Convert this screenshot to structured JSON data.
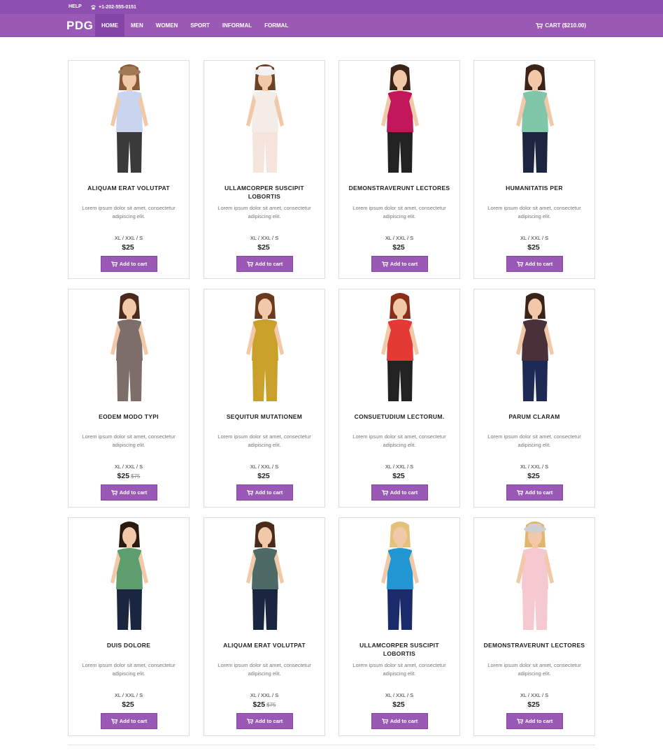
{
  "topbar": {
    "help": "HELP",
    "phone": "+1-202-555-0151"
  },
  "nav": {
    "brand": "PDG",
    "items": [
      "HOME",
      "MEN",
      "WOMEN",
      "SPORT",
      "INFORMAL",
      "FORMAL"
    ],
    "cart": "CART ($210.00)"
  },
  "products": [
    {
      "title": "ALIQUAM ERAT VOLUTPAT",
      "desc": "Lorem ipsum dolor sit amet, consectetur adipiscing elit.",
      "sizes": "XL / XXL / S",
      "price": "$25",
      "old_price": "",
      "button": "Add to cart",
      "colors": {
        "top": "#c9d4ee",
        "bottom": "#3a3a3a",
        "hair": "#8a5a3a",
        "hat": "#a07a55"
      }
    },
    {
      "title": "ULLAMCORPER SUSCIPIT LOBORTIS",
      "desc": "Lorem ipsum dolor sit amet, consectetur adipiscing elit.",
      "sizes": "XL / XXL / S",
      "price": "$25",
      "old_price": "",
      "button": "Add to cart",
      "colors": {
        "top": "#f4ece6",
        "bottom": "#f4e4dc",
        "hair": "#6b4226",
        "hat": "#f2f2f2"
      }
    },
    {
      "title": "DEMONSTRAVERUNT LECTORES",
      "desc": "Lorem ipsum dolor sit amet, consectetur adipiscing elit.",
      "sizes": "XL / XXL / S",
      "price": "$25",
      "old_price": "",
      "button": "Add to cart",
      "colors": {
        "top": "#c2185b",
        "bottom": "#222222",
        "hair": "#3a2418",
        "hat": ""
      }
    },
    {
      "title": "HUMANITATIS PER",
      "desc": "Lorem ipsum dolor sit amet, consectetur adipiscing elit.",
      "sizes": "XL / XXL / S",
      "price": "$25",
      "old_price": "",
      "button": "Add to cart",
      "colors": {
        "top": "#7fc7a8",
        "bottom": "#1d2540",
        "hair": "#3a2418",
        "hat": ""
      }
    },
    {
      "title": "EODEM MODO TYPI",
      "desc": "Lorem ipsum dolor sit amet, consectetur adipiscing elit.",
      "sizes": "XL / XXL / S",
      "price": "$25",
      "old_price": "$75",
      "button": "Add to cart",
      "colors": {
        "top": "#7d6e6a",
        "bottom": "#7d6e6a",
        "hair": "#4a2a1a",
        "hat": ""
      }
    },
    {
      "title": "SEQUITUR MUTATIONEM",
      "desc": "Lorem ipsum dolor sit amet, consectetur adipiscing elit.",
      "sizes": "XL / XXL / S",
      "price": "$25",
      "old_price": "",
      "button": "Add to cart",
      "colors": {
        "top": "#c9a02a",
        "bottom": "#c9a02a",
        "hair": "#6b3a1e",
        "hat": ""
      }
    },
    {
      "title": "CONSUETUDIUM LECTORUM.",
      "desc": "Lorem ipsum dolor sit amet, consectetur adipiscing elit.",
      "sizes": "XL / XXL / S",
      "price": "$25",
      "old_price": "",
      "button": "Add to cart",
      "colors": {
        "top": "#e53935",
        "bottom": "#222222",
        "hair": "#8a2e1a",
        "hat": ""
      }
    },
    {
      "title": "PARUM CLARAM",
      "desc": "Lorem ipsum dolor sit amet, consectetur adipiscing elit.",
      "sizes": "XL / XXL / S",
      "price": "$25",
      "old_price": "",
      "button": "Add to cart",
      "colors": {
        "top": "#4a3038",
        "bottom": "#1d2a55",
        "hair": "#3a2418",
        "hat": ""
      }
    },
    {
      "title": "DUIS DOLORE",
      "desc": "Lorem ipsum dolor sit amet, consectetur adipiscing elit.",
      "sizes": "XL / XXL / S",
      "price": "$25",
      "old_price": "",
      "button": "Add to cart",
      "colors": {
        "top": "#5e9e6e",
        "bottom": "#1a2540",
        "hair": "#2a1a10",
        "hat": ""
      }
    },
    {
      "title": "ALIQUAM ERAT VOLUTPAT",
      "desc": "Lorem ipsum dolor sit amet, consectetur adipiscing elit.",
      "sizes": "XL / XXL / S",
      "price": "$25",
      "old_price": "$75",
      "button": "Add to cart",
      "colors": {
        "top": "#4e6a66",
        "bottom": "#1a2540",
        "hair": "#4a2a1a",
        "hat": ""
      }
    },
    {
      "title": "ULLAMCORPER SUSCIPIT LOBORTIS",
      "desc": "Lorem ipsum dolor sit amet, consectetur adipiscing elit.",
      "sizes": "XL / XXL / S",
      "price": "$25",
      "old_price": "",
      "button": "Add to cart",
      "colors": {
        "top": "#2196d3",
        "bottom": "#1a2a6a",
        "hair": "#e5c27a",
        "hat": ""
      }
    },
    {
      "title": "DEMONSTRAVERUNT LECTORES",
      "desc": "Lorem ipsum dolor sit amet, consectetur adipiscing elit.",
      "sizes": "XL / XXL / S",
      "price": "$25",
      "old_price": "",
      "button": "Add to cart",
      "colors": {
        "top": "#f6c8d0",
        "bottom": "#f6c8d0",
        "hair": "#e2b66a",
        "hat": "#cfcfcf"
      }
    }
  ],
  "theme": {
    "accent": "#9b59b6",
    "accent_dark": "#8445a6",
    "topbar": "#8e4fb0"
  }
}
